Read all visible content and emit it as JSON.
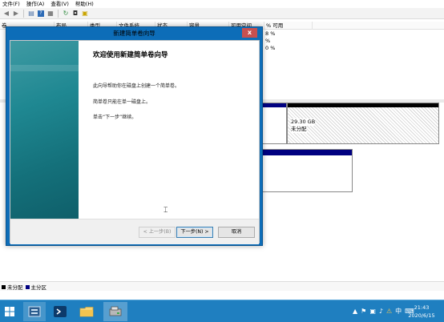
{
  "menubar": {
    "items": [
      "文件(F)",
      "操作(A)",
      "查看(V)",
      "帮助(H)"
    ]
  },
  "toolbar": {
    "icons": [
      "back-icon",
      "forward-icon",
      "list-icon",
      "help-icon",
      "properties-icon",
      "refresh-icon",
      "new-volume-icon",
      "disk-icon"
    ]
  },
  "volume_list": {
    "columns": [
      "卷",
      "布局",
      "类型",
      "文件系统",
      "状态",
      "容量",
      "可用空间",
      "% 可用"
    ],
    "rows": [
      {
        "pct": "8 %"
      },
      {
        "pct": "%"
      },
      {
        "pct": "0 %"
      }
    ]
  },
  "disk_map": {
    "unallocated_size": "29.30 GB",
    "unallocated_label": "未分配"
  },
  "legend": [
    {
      "label": "未分配",
      "color": "#000000"
    },
    {
      "label": "主分区",
      "color": "#000080"
    }
  ],
  "dialog": {
    "title": "新建简单卷向导",
    "close_label": "x",
    "heading": "欢迎使用新建简单卷向导",
    "para1": "此向导帮助你在磁盘上创建一个简单卷。",
    "para2": "简单卷只能在单一磁盘上。",
    "para3": "单击“下一步”继续。",
    "back_label": "< 上一步(B)",
    "next_label": "下一步(N) >",
    "cancel_label": "取消"
  },
  "taskbar": {
    "time": "21:43",
    "date": "2020/6/15"
  }
}
